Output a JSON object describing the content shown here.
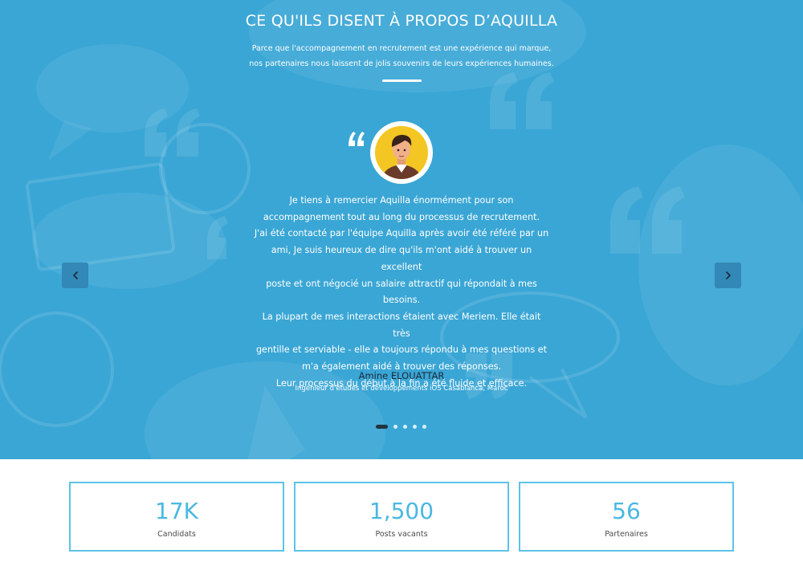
{
  "colors": {
    "hero_background": "#3aa6d5",
    "accent": "#4ab8e2",
    "nav_button": "#3288b6",
    "author_name": "#1c2a3a"
  },
  "testimonials": {
    "title": "CE QU'ILS DISENT À PROPOS D’AQUILLA",
    "subtitle_line1": "Parce que l'accompagnement en recrutement est une expérience qui marque,",
    "subtitle_line2": "nos partenaires nous laissent de jolis souvenirs de leurs expériences humaines.",
    "quote_icon": "quote-icon",
    "avatar_icon": "avatar-man-icon",
    "quote_lines": [
      "Je tiens à remercier Aquilla énormément pour son",
      "accompagnement tout au long du processus de recrutement.",
      "J'ai été contacté par l'équipe Aquilla après avoir été référé par un",
      "ami, Je suis heureux de dire qu'ils m'ont aidé à trouver un excellent",
      "poste et ont négocié un salaire attractif qui répondait à mes",
      "besoins.",
      "La plupart de mes interactions étaient avec Meriem. Elle était très",
      "gentille et serviable - elle a toujours répondu à mes questions et",
      "m'a également aidé à trouver des réponses.",
      "Leur processus du début à la fin a été fluide et efficace."
    ],
    "author_name": "Amine ELOUATTAR",
    "author_role": "Ingénieur d'études et développements iOS Casablanca, Maroc",
    "prev_icon": "chevron-left-icon",
    "next_icon": "chevron-right-icon",
    "slides_total": 5,
    "active_slide": 1
  },
  "stats": [
    {
      "value": "17K",
      "label": "Candidats"
    },
    {
      "value": "1,500",
      "label": "Posts vacants"
    },
    {
      "value": "56",
      "label": "Partenaires"
    }
  ]
}
